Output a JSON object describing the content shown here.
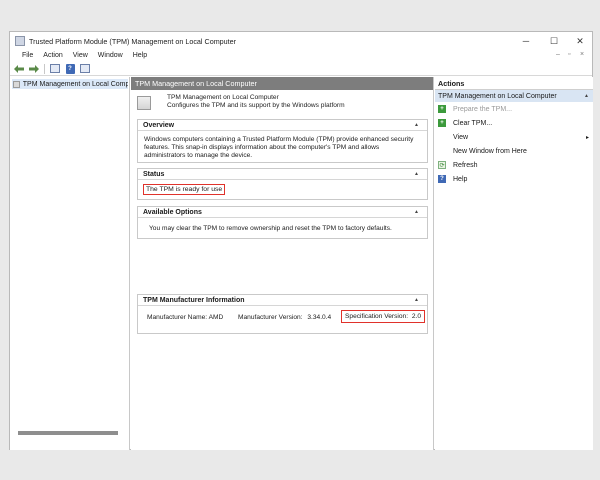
{
  "window": {
    "title": "Trusted Platform Module (TPM) Management on Local Computer",
    "controls": {
      "minimize": "─",
      "maximize": "☐",
      "close": "✕"
    },
    "mdi_controls": {
      "minimize": "–",
      "restore": "▫",
      "close": "×"
    }
  },
  "menu": [
    "File",
    "Action",
    "View",
    "Window",
    "Help"
  ],
  "toolbar": {
    "back_icon": "arrow-left-icon",
    "forward_icon": "arrow-right-icon"
  },
  "tree": {
    "selected_label": "TPM Management on Local Compu"
  },
  "center": {
    "header": "TPM Management on Local Computer",
    "intro_line1": "TPM Management on Local Computer",
    "intro_line2": "Configures the TPM and its support by the Windows platform",
    "overview": {
      "title": "Overview",
      "text": "Windows computers containing a Trusted Platform Module (TPM) provide enhanced security features. This snap-in displays information about the computer's TPM and allows administrators to manage the device."
    },
    "status": {
      "title": "Status",
      "text": "The TPM is ready for use"
    },
    "available_options": {
      "title": "Available Options",
      "text": "You may clear the TPM to remove ownership and reset the TPM to factory defaults."
    },
    "manufacturer": {
      "title": "TPM Manufacturer Information",
      "name_label": "Manufacturer Name:",
      "name_value": "AMD",
      "version_label": "Manufacturer Version:",
      "version_value": "3.34.0.4",
      "spec_label": "Specification Version:",
      "spec_value": "2.0"
    }
  },
  "actions": {
    "title": "Actions",
    "group": "TPM Management on Local Computer",
    "items": [
      {
        "label": "Prepare the TPM...",
        "icon": "green-plus-icon",
        "disabled": true
      },
      {
        "label": "Clear TPM...",
        "icon": "green-plus-icon",
        "disabled": false
      },
      {
        "label": "View",
        "icon": "",
        "disabled": false,
        "submenu": "▸"
      },
      {
        "label": "New Window from Here",
        "icon": "",
        "disabled": false
      },
      {
        "label": "Refresh",
        "icon": "refresh-icon",
        "disabled": false
      },
      {
        "label": "Help",
        "icon": "help-icon",
        "disabled": false
      }
    ]
  },
  "colors": {
    "highlight_box": "#e0322b",
    "header_gray": "#7d7d7d",
    "selection_blue": "#d9e5f3"
  }
}
